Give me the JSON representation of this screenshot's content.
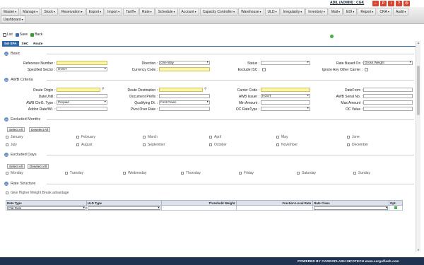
{
  "user": {
    "label": "ADIL (ADMIN) : CGK"
  },
  "top_icons": [
    {
      "name": "home-icon",
      "glyph": "⌂",
      "color": "#d9432f"
    },
    {
      "name": "profile-icon",
      "glyph": "P",
      "color": "#d9432f"
    },
    {
      "name": "info-icon",
      "glyph": "i",
      "color": "#d9432f"
    },
    {
      "name": "help-icon",
      "glyph": "?",
      "color": "#d9432f"
    },
    {
      "name": "logout-icon",
      "glyph": "⏻",
      "color": "#d9432f"
    }
  ],
  "menu": {
    "row1": [
      "Master",
      "Manage",
      "Stock",
      "Reservation",
      "Export",
      "Import",
      "Tariff",
      "Rate",
      "Schedule",
      "Account",
      "Capacity Controller",
      "Warehouse",
      "ULD",
      "Irregularity",
      "Inventory",
      "Mail",
      "EDI",
      "Report",
      "CRA",
      "Audit"
    ],
    "row2": [
      "Dashboard"
    ]
  },
  "toolbar": {
    "list": "List",
    "save": "Save",
    "back": "Back"
  },
  "tabs": [
    "Set SPA",
    "SHC",
    "Route"
  ],
  "sections": {
    "basic": "Basic",
    "awb": "AWB Criteria",
    "excluded_months": "Excluded Months",
    "excluded_days": "Excluded Days",
    "rate_structure": "Rate Structure"
  },
  "basic": {
    "reference_number": "Reference Number :",
    "specified_sector": "Specified Sector :",
    "specified_sector_value": "HOST",
    "direction": "Direction :",
    "direction_value": "One Way",
    "currency_code": "Currency Code :",
    "status": "Status :",
    "exclude_isc": "Exclude ISC :",
    "rate_based_on": "Rate Based On :",
    "rate_based_on_value": "Gross Weight",
    "ignore_other_carrier": "Ignore Any Other Carrier :"
  },
  "awb": {
    "route_origin": "Route Origin :",
    "date_until": "DateUntil :",
    "awb_chrg_type": "AWB ChrG. Type :",
    "awb_chrg_type_value": "Prepaid",
    "addon_rate": "Addon Rate/Wt. :",
    "route_destination": "Route Destination :",
    "document_prefix": "Document Prefix :",
    "qualifying_dt": "Qualifying Dt. :",
    "qualifying_dt_value": "First Flown",
    "pivot_over_rate": "Pivot Over Rate :",
    "carrier_code": "Carrier Code :",
    "awb_issuer": "AWB Issuer :",
    "awb_issuer_value": "HOST",
    "min_amount": "Min Amount :",
    "oc_rate_type": "OC RateType :",
    "date_from": "DateFrom :",
    "awb_serial_no": "AWB Serial No. :",
    "max_amount": "Max Amount :",
    "oc_value": "OC Value :"
  },
  "buttons": {
    "select_all": "Select All",
    "deselect_all": "Deselect All"
  },
  "months": [
    "January",
    "February",
    "March",
    "April",
    "May",
    "June",
    "July",
    "August",
    "September",
    "October",
    "November",
    "December"
  ],
  "days": [
    "Monday",
    "Tuesday",
    "Wednesday",
    "Thursday",
    "Friday",
    "Saturday",
    "Sunday"
  ],
  "rate_structure": {
    "give_higher_weight": "Give Higher Weight Break advantage",
    "columns": [
      "Rate Type",
      "ULD Type",
      "Threshold Weight",
      "Fraction Local Rate",
      "Rate Class",
      "Opt."
    ],
    "row": {
      "rate_type": "Flat Rate"
    }
  },
  "footer": "POWERED BY CARGOFLASH INFOTECH www.cargoflash.com"
}
